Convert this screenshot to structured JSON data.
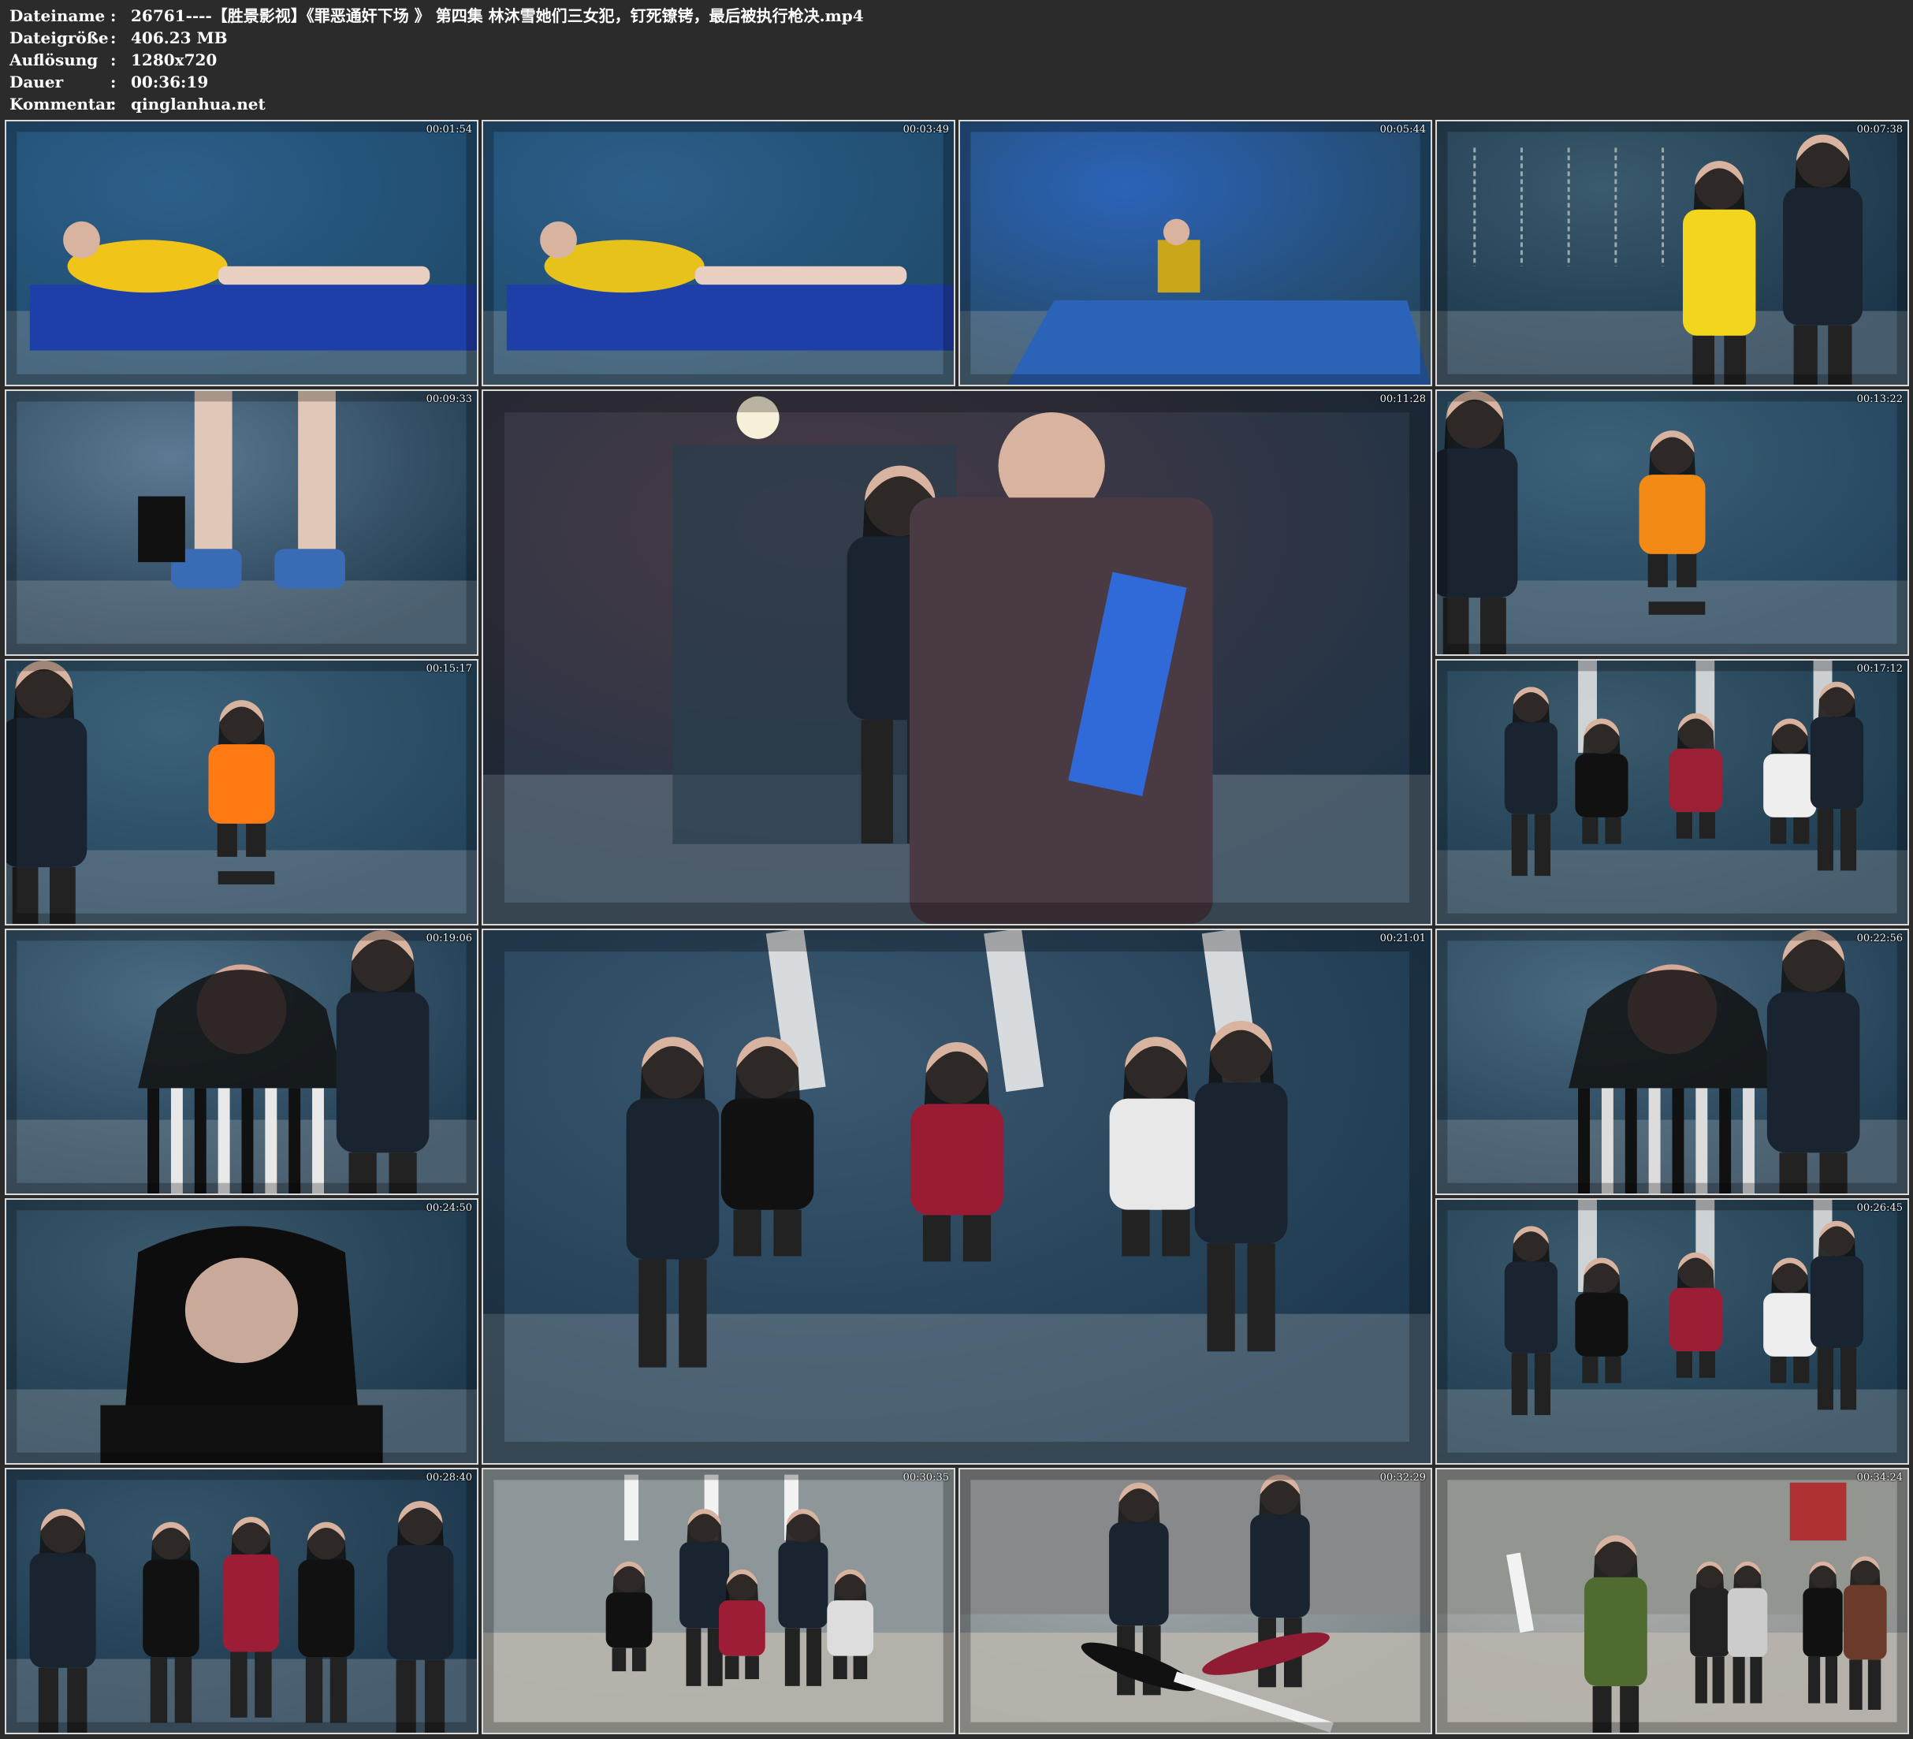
{
  "header": {
    "rows": [
      {
        "key": "Dateiname",
        "sep": ":",
        "value": "26761----【胜景影视】《罪恶通奸下场 》 第四集 林沐雪她们三女犯，钉死镣铐，最后被执行枪决.mp4"
      },
      {
        "key": "Dateigröße",
        "sep": ":",
        "value": "406.23 MB"
      },
      {
        "key": "Auflösung",
        "sep": ":",
        "value": "1280x720"
      },
      {
        "key": "Dauer",
        "sep": ":",
        "value": "00:36:19"
      },
      {
        "key": "Kommentar",
        "sep": ":",
        "value": "qinglanhua.net"
      }
    ]
  },
  "thumbnails": [
    {
      "time": "00:01:54",
      "scene": "cell-bed",
      "palette": [
        "#1f4a6b",
        "#2c5f8a",
        "#f0c419"
      ]
    },
    {
      "time": "00:03:49",
      "scene": "cell-bed",
      "palette": [
        "#1d4260",
        "#2a55a0",
        "#e6c21a"
      ]
    },
    {
      "time": "00:05:44",
      "scene": "cell-floor",
      "palette": [
        "#24475f",
        "#2b63b8",
        "#c9a61a"
      ]
    },
    {
      "time": "00:07:38",
      "scene": "chains-guard",
      "palette": [
        "#1a3347",
        "#3a5a6e",
        "#f2d51c"
      ]
    },
    {
      "time": "00:09:33",
      "scene": "shackles",
      "palette": [
        "#20394d",
        "#5c7a93",
        "#3a6cb5"
      ]
    },
    {
      "time": "00:11:28",
      "scene": "officer-large",
      "palette": [
        "#1e3346",
        "#4a3a44",
        "#2f6ad8"
      ]
    },
    {
      "time": "00:13:22",
      "scene": "seated-prisoner",
      "palette": [
        "#23445c",
        "#3c6178",
        "#f28a14"
      ]
    },
    {
      "time": "00:15:17",
      "scene": "seated-prisoner",
      "palette": [
        "#223e52",
        "#516d7f",
        "#ff7a12"
      ]
    },
    {
      "time": "00:17:12",
      "scene": "kneeling-three",
      "palette": [
        "#1d3a4f",
        "#3b5a6c",
        "#9c2035"
      ]
    },
    {
      "time": "00:19:06",
      "scene": "closeup",
      "palette": [
        "#203b50",
        "#4a6b82",
        "#e8e8e8"
      ]
    },
    {
      "time": "00:21:01",
      "scene": "kneeling-large",
      "palette": [
        "#1d384e",
        "#3a5870",
        "#9a1c34"
      ]
    },
    {
      "time": "00:22:56",
      "scene": "closeup",
      "palette": [
        "#1f3a4e",
        "#466479",
        "#dcdcdc"
      ]
    },
    {
      "time": "00:24:50",
      "scene": "closeup-face",
      "palette": [
        "#1e394d",
        "#3c5a6d",
        "#c9a99a"
      ]
    },
    {
      "time": "00:26:45",
      "scene": "kneeling-three",
      "palette": [
        "#1c374c",
        "#3a576b",
        "#9b1e36"
      ]
    },
    {
      "time": "00:28:40",
      "scene": "standing-line",
      "palette": [
        "#1b354a",
        "#35546a",
        "#9c1d35"
      ]
    },
    {
      "time": "00:30:35",
      "scene": "outdoor-kneel",
      "palette": [
        "#7e8a8f",
        "#a9b1b3",
        "#9c1d35"
      ]
    },
    {
      "time": "00:32:29",
      "scene": "outdoor-ground",
      "palette": [
        "#7b8589",
        "#a7aeb0",
        "#8f1c33"
      ]
    },
    {
      "time": "00:34:24",
      "scene": "outdoor-crowd",
      "palette": [
        "#8a8f8f",
        "#b3b6b3",
        "#4f6b2f"
      ]
    }
  ]
}
